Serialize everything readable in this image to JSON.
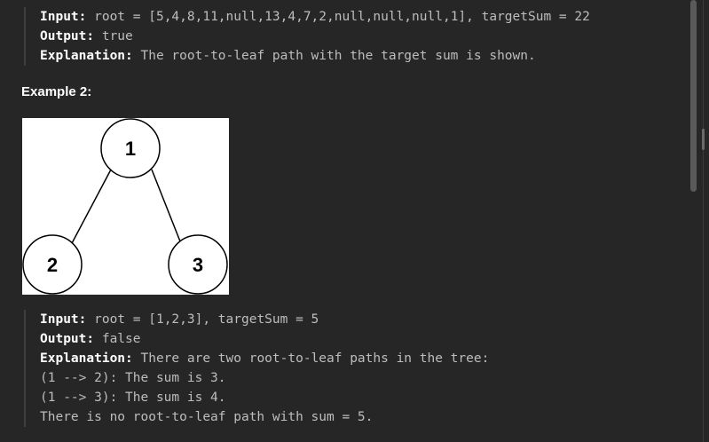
{
  "example1": {
    "input_key": "Input:",
    "input_value": " root = [5,4,8,11,null,13,4,7,2,null,null,null,1], targetSum = 22",
    "output_key": "Output:",
    "output_value": " true",
    "explanation_key": "Explanation:",
    "explanation_value": " The root-to-leaf path with the target sum is shown."
  },
  "example2": {
    "title": "Example 2:",
    "tree": {
      "nodes": [
        "1",
        "2",
        "3"
      ]
    },
    "input_key": "Input:",
    "input_value": " root = [1,2,3], targetSum = 5",
    "output_key": "Output:",
    "output_value": " false",
    "explanation_key": "Explanation:",
    "explanation_value": " There are two root-to-leaf paths in the tree:",
    "lines": [
      "(1 --> 2): The sum is 3.",
      "(1 --> 3): The sum is 4.",
      "There is no root-to-leaf path with sum = 5."
    ]
  }
}
